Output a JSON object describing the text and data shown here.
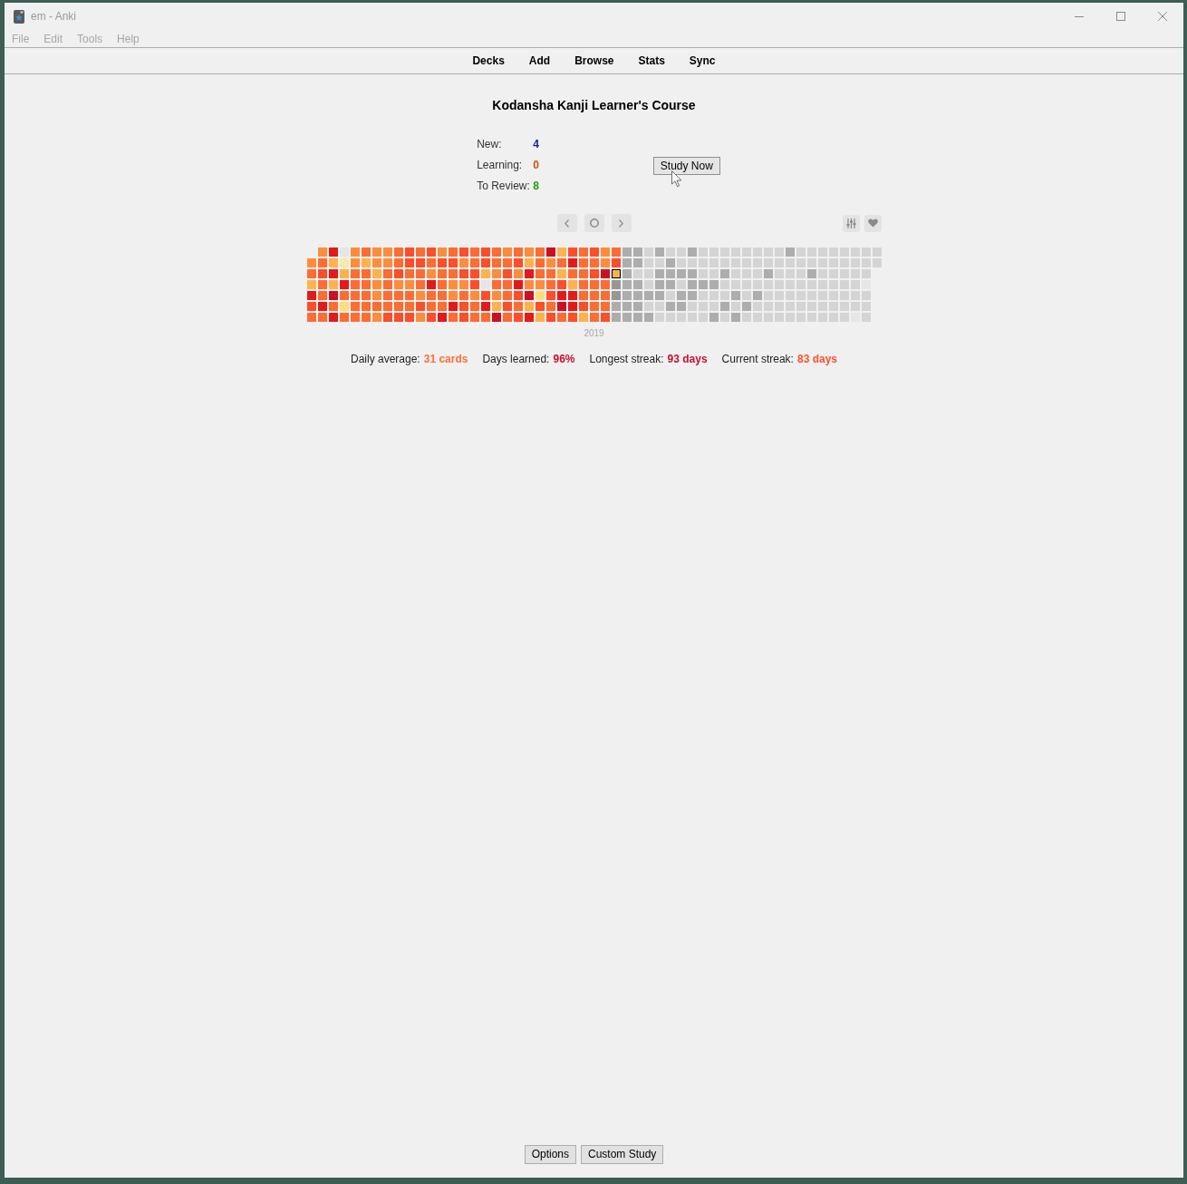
{
  "window": {
    "title": "em - Anki"
  },
  "menu_bar": [
    "File",
    "Edit",
    "Tools",
    "Help"
  ],
  "toolbar": [
    "Decks",
    "Add",
    "Browse",
    "Stats",
    "Sync"
  ],
  "deck": {
    "title": "Kodansha Kanji Learner's Course",
    "counts": [
      {
        "label": "New:",
        "value": "4",
        "color": "#1a1aa6"
      },
      {
        "label": "Learning:",
        "value": "0",
        "color": "#c35617"
      },
      {
        "label": "To Review:",
        "value": "8",
        "color": "#1f9c1f"
      }
    ],
    "study_button": "Study Now"
  },
  "heatmap": {
    "year_label": "2019"
  },
  "stats": [
    {
      "label": "Daily average:",
      "value": "31 cards",
      "color": "#fd7036"
    },
    {
      "label": "Days learned:",
      "value": "96%",
      "color": "#c8102e"
    },
    {
      "label": "Longest streak:",
      "value": "93 days",
      "color": "#c8102e"
    },
    {
      "label": "Current streak:",
      "value": "83 days",
      "color": "#fc5230"
    }
  ],
  "bottom_buttons": [
    "Options",
    "Custom Study"
  ]
}
